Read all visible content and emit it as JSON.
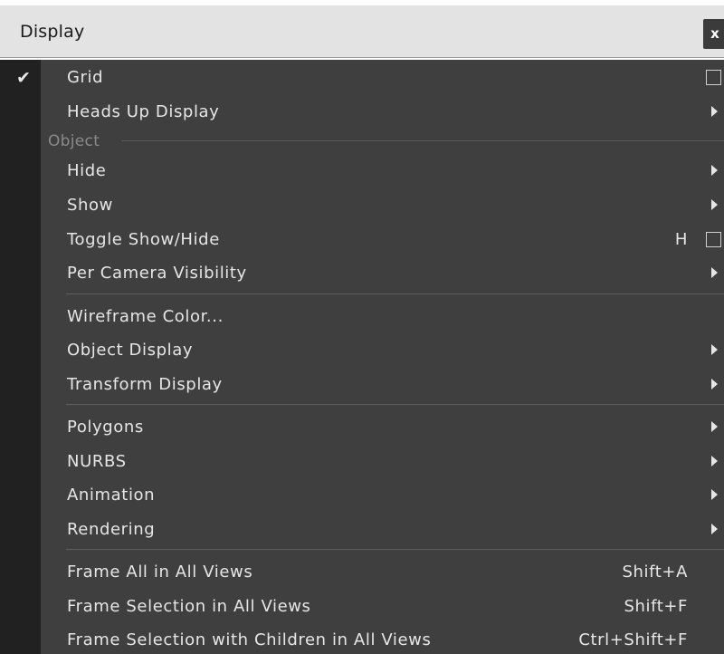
{
  "window": {
    "title": "Display",
    "close_label": "x"
  },
  "menu": {
    "grid": {
      "label": "Grid",
      "checked": true,
      "has_checkbox": true
    },
    "heads_up_display": {
      "label": "Heads Up Display",
      "submenu": true
    },
    "section_object": {
      "label": "Object"
    },
    "hide": {
      "label": "Hide",
      "submenu": true
    },
    "show": {
      "label": "Show",
      "submenu": true
    },
    "toggle_show_hide": {
      "label": "Toggle Show/Hide",
      "shortcut": "H",
      "has_checkbox": true
    },
    "per_camera_visibility": {
      "label": "Per Camera Visibility",
      "submenu": true
    },
    "wireframe_color": {
      "label": "Wireframe Color..."
    },
    "object_display": {
      "label": "Object Display",
      "submenu": true
    },
    "transform_display": {
      "label": "Transform Display",
      "submenu": true
    },
    "polygons": {
      "label": "Polygons",
      "submenu": true
    },
    "nurbs": {
      "label": "NURBS",
      "submenu": true
    },
    "animation": {
      "label": "Animation",
      "submenu": true
    },
    "rendering": {
      "label": "Rendering",
      "submenu": true
    },
    "frame_all": {
      "label": "Frame All in All Views",
      "shortcut": "Shift+A"
    },
    "frame_selection": {
      "label": "Frame Selection in All Views",
      "shortcut": "Shift+F"
    },
    "frame_selection_children": {
      "label": "Frame Selection with Children in All Views",
      "shortcut": "Ctrl+Shift+F"
    }
  },
  "icons": {
    "checkmark": "check-icon",
    "submenu": "chevron-right-icon",
    "close": "close-icon"
  },
  "colors": {
    "menu_background": "#3f3f3f",
    "gutter_background": "#212121",
    "titlebar_background": "#e3e3e3",
    "text": "#e6e6e6",
    "section_text": "#8a8a8a"
  }
}
